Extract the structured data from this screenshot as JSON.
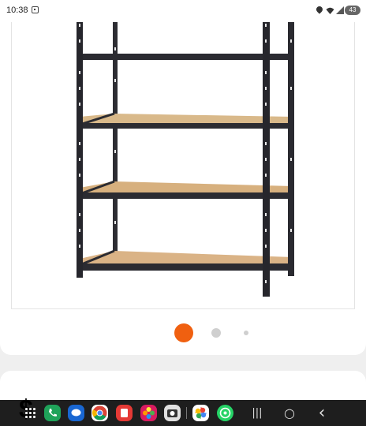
{
  "status_bar": {
    "time": "10:38",
    "battery": "43",
    "icons": [
      "screenshot-icon",
      "location-icon",
      "wifi-icon",
      "signal-icon",
      "battery-icon"
    ]
  },
  "product": {
    "image": "metal-storage-shelving-5-tier",
    "gallery": {
      "total_pages": 3,
      "current_page": 1
    }
  },
  "taskbar": {
    "apps": [
      "apps-grid-icon",
      "phone-icon",
      "messages-icon",
      "chrome-icon",
      "notes-icon",
      "gallery-icon",
      "camera-icon",
      "photos-icon",
      "whatsapp-icon"
    ],
    "nav": {
      "recents": "|||",
      "home": "○",
      "back": "‹"
    }
  },
  "colors": {
    "accent": "#f06010",
    "inactive_dot": "#cfcfcf",
    "taskbar": "#1e1e1e"
  }
}
